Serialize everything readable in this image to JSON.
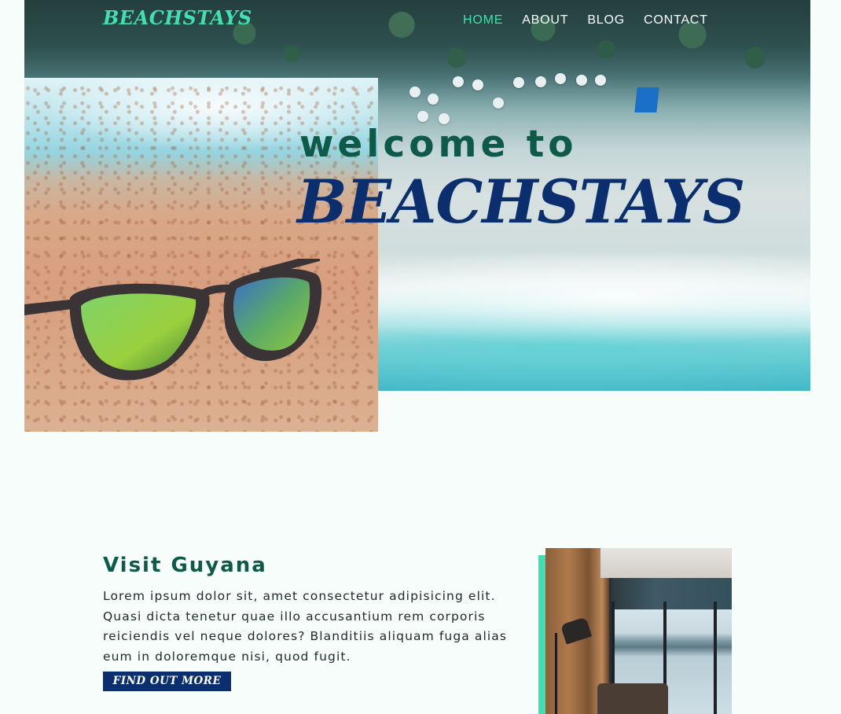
{
  "brand": {
    "logo_text": "BEACHSTAYS",
    "accent_color": "#3fe0b4",
    "primary_color": "#0b2f6e",
    "heading_color": "#0e5a48"
  },
  "nav": {
    "items": [
      {
        "label": "HOME",
        "active": true
      },
      {
        "label": "ABOUT",
        "active": false
      },
      {
        "label": "BLOG",
        "active": false
      },
      {
        "label": "CONTACT",
        "active": false
      }
    ]
  },
  "hero": {
    "welcome_text": "welcome to",
    "brand_text": "BEACHSTAYS",
    "images": [
      "aerial-beach-photo",
      "sunglasses-on-sand-photo"
    ]
  },
  "feature": {
    "title": "Visit Guyana",
    "body": "Lorem ipsum dolor sit, amet consectetur adipisicing elit. Quasi dicta tenetur quae illo accusantium rem corporis reiciendis vel neque dolores? Blanditiis aliquam fuga alias eum in doloremque nisi, quod fugit.",
    "cta_label": "FIND OUT MORE",
    "image": "lake-view-room-photo"
  }
}
